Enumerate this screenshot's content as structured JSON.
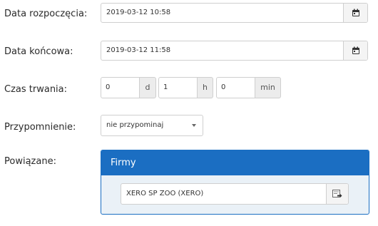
{
  "form": {
    "start": {
      "label": "Data rozpoczęcia:",
      "value": "2019-03-12 10:58",
      "icon": "calendar-icon"
    },
    "end": {
      "label": "Data końcowa:",
      "value": "2019-03-12 11:58",
      "icon": "calendar-icon"
    },
    "duration": {
      "label": "Czas trwania:",
      "days": "0",
      "days_unit": "d",
      "hours": "1",
      "hours_unit": "h",
      "minutes": "0",
      "minutes_unit": "min"
    },
    "reminder": {
      "label": "Przypomnienie:",
      "value": "nie przypominaj"
    },
    "related": {
      "label": "Powiązane:",
      "panel_title": "Firmy",
      "company": "XERO SP ZOO (XERO)",
      "icon": "select-record-icon"
    }
  },
  "colors": {
    "accent": "#1b6ec2",
    "panel_bg": "#eaf1f7",
    "border": "#cfcfcf"
  }
}
